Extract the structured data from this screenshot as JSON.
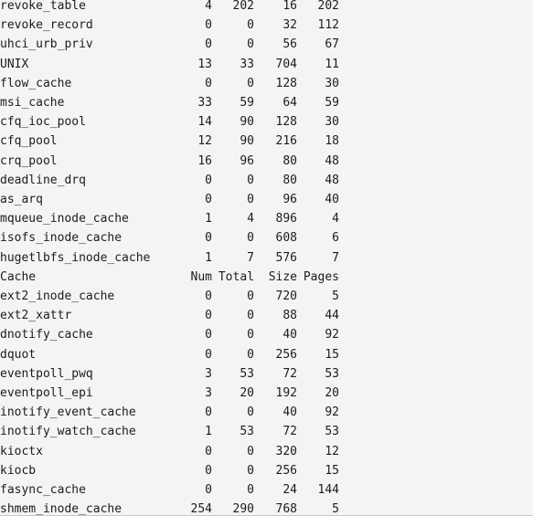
{
  "pane": {
    "name": "slabtop-output",
    "background_color": "#f4f4f3",
    "text_color": "#1c1c1c",
    "border_color": "#c8c8c8"
  },
  "columns": {
    "name": "Cache",
    "num": "Num",
    "total": "Total",
    "size": "Size",
    "pages": "Pages"
  },
  "rows": [
    {
      "kind": "data",
      "name": "revoke_table",
      "num": "4",
      "total": "202",
      "size": "16",
      "pages": "202"
    },
    {
      "kind": "data",
      "name": "revoke_record",
      "num": "0",
      "total": "0",
      "size": "32",
      "pages": "112"
    },
    {
      "kind": "data",
      "name": "uhci_urb_priv",
      "num": "0",
      "total": "0",
      "size": "56",
      "pages": "67"
    },
    {
      "kind": "data",
      "name": "UNIX",
      "num": "13",
      "total": "33",
      "size": "704",
      "pages": "11"
    },
    {
      "kind": "data",
      "name": "flow_cache",
      "num": "0",
      "total": "0",
      "size": "128",
      "pages": "30"
    },
    {
      "kind": "data",
      "name": "msi_cache",
      "num": "33",
      "total": "59",
      "size": "64",
      "pages": "59"
    },
    {
      "kind": "data",
      "name": "cfq_ioc_pool",
      "num": "14",
      "total": "90",
      "size": "128",
      "pages": "30"
    },
    {
      "kind": "data",
      "name": "cfq_pool",
      "num": "12",
      "total": "90",
      "size": "216",
      "pages": "18"
    },
    {
      "kind": "data",
      "name": "crq_pool",
      "num": "16",
      "total": "96",
      "size": "80",
      "pages": "48"
    },
    {
      "kind": "data",
      "name": "deadline_drq",
      "num": "0",
      "total": "0",
      "size": "80",
      "pages": "48"
    },
    {
      "kind": "data",
      "name": "as_arq",
      "num": "0",
      "total": "0",
      "size": "96",
      "pages": "40"
    },
    {
      "kind": "data",
      "name": "mqueue_inode_cache",
      "num": "1",
      "total": "4",
      "size": "896",
      "pages": "4"
    },
    {
      "kind": "data",
      "name": "isofs_inode_cache",
      "num": "0",
      "total": "0",
      "size": "608",
      "pages": "6"
    },
    {
      "kind": "data",
      "name": "hugetlbfs_inode_cache",
      "num": "1",
      "total": "7",
      "size": "576",
      "pages": "7"
    },
    {
      "kind": "header",
      "name": "Cache",
      "num": "Num",
      "total": "Total",
      "size": "Size",
      "pages": "Pages"
    },
    {
      "kind": "data",
      "name": "ext2_inode_cache",
      "num": "0",
      "total": "0",
      "size": "720",
      "pages": "5"
    },
    {
      "kind": "data",
      "name": "ext2_xattr",
      "num": "0",
      "total": "0",
      "size": "88",
      "pages": "44"
    },
    {
      "kind": "data",
      "name": "dnotify_cache",
      "num": "0",
      "total": "0",
      "size": "40",
      "pages": "92"
    },
    {
      "kind": "data",
      "name": "dquot",
      "num": "0",
      "total": "0",
      "size": "256",
      "pages": "15"
    },
    {
      "kind": "data",
      "name": "eventpoll_pwq",
      "num": "3",
      "total": "53",
      "size": "72",
      "pages": "53"
    },
    {
      "kind": "data",
      "name": "eventpoll_epi",
      "num": "3",
      "total": "20",
      "size": "192",
      "pages": "20"
    },
    {
      "kind": "data",
      "name": "inotify_event_cache",
      "num": "0",
      "total": "0",
      "size": "40",
      "pages": "92"
    },
    {
      "kind": "data",
      "name": "inotify_watch_cache",
      "num": "1",
      "total": "53",
      "size": "72",
      "pages": "53"
    },
    {
      "kind": "data",
      "name": "kioctx",
      "num": "0",
      "total": "0",
      "size": "320",
      "pages": "12"
    },
    {
      "kind": "data",
      "name": "kiocb",
      "num": "0",
      "total": "0",
      "size": "256",
      "pages": "15"
    },
    {
      "kind": "data",
      "name": "fasync_cache",
      "num": "0",
      "total": "0",
      "size": "24",
      "pages": "144"
    },
    {
      "kind": "data",
      "name": "shmem_inode_cache",
      "num": "254",
      "total": "290",
      "size": "768",
      "pages": "5"
    }
  ]
}
